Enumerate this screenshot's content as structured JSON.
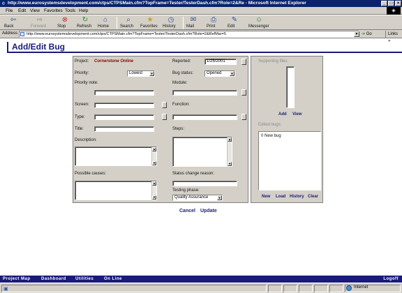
{
  "window": {
    "title": "http://www.eurosystemsdevelopment.com/ctps/CTPSMain.cfm?TopFrame=Tester/TesterDash.cfm?Role=2&Re - Microsoft Internet Explorer",
    "minimize": "_",
    "maximize": "□",
    "close": "×"
  },
  "menu": [
    "File",
    "Edit",
    "View",
    "Favorites",
    "Tools",
    "Help"
  ],
  "toolbar": {
    "back": "Back",
    "forward": "Forward",
    "stop": "Stop",
    "refresh": "Refresh",
    "home": "Home",
    "search": "Search",
    "favorites": "Favorites",
    "history": "History",
    "mail": "Mail",
    "print": "Print",
    "edit": "Edit",
    "messenger": "Messenger"
  },
  "address": {
    "label": "Address",
    "url": "http://www.eurosystemsdevelopment.com/ctps/CTPSMain.cfm?TopFrame=Tester/TesterDash.cfm?Role=2&RefMar=5",
    "go": "Go",
    "links": "Links"
  },
  "page": {
    "title": "Add/Edit Bug"
  },
  "form": {
    "project_label": "Project:",
    "project_value": "Cornerstone Online",
    "reported_label": "Reported:",
    "reported_value": "1/25/2001",
    "priority_label": "Priority:",
    "priority_value": "Lowest",
    "bug_status_label": "Bug status:",
    "bug_status_value": "Opened",
    "priority_note_label": "Priority note:",
    "module_label": "Module:",
    "screen_label": "Screen:",
    "function_label": "Function:",
    "type_label": "Type:",
    "title_label": "Title:",
    "steps_label": "Steps:",
    "description_label": "Description:",
    "possible_causes_label": "Possible causes:",
    "status_change_reason_label": "Status change reason:",
    "testing_phase_label": "Testing phase:",
    "testing_phase_value": "Quality Assurance"
  },
  "supporting_files": {
    "heading": "Supporting files:",
    "add": "Add",
    "view": "View"
  },
  "edited_bugs": {
    "heading": "Edited bugs:",
    "items": [
      "0 New bug"
    ],
    "new": "New",
    "load": "Load",
    "history": "History",
    "clear": "Clear"
  },
  "actions": {
    "cancel": "Cancel",
    "update": "Update"
  },
  "footer_nav": {
    "project_map": "Project Map",
    "dashboard": "Dashboard",
    "utilities": "Utilities",
    "on_line": "On Line",
    "logoff": "Logoff"
  },
  "status": {
    "zone": "Internet"
  }
}
